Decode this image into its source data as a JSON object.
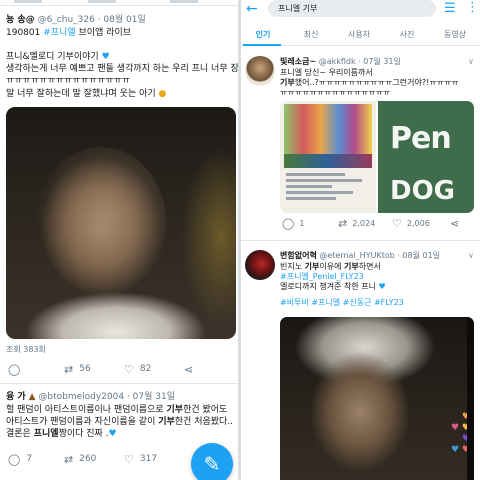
{
  "left_pane": {
    "top_tweet": {
      "user_name": "뇽 송@",
      "handle_date": "@6_chu_326 · 08월 01일",
      "line1_date": "190801",
      "line1_tag": "#프니엘",
      "line1_rest": "브이앱 라이브",
      "line2": "프니&멜로디 기부이야기",
      "line3": "생각하는게 너무 예쁘고 팬들 생각까지 하는 우리 프니 너무 장해",
      "line4": "ㅠㅠㅠㅠㅠㅠㅠㅠㅠㅠㅠㅠㅠㅠㅠ",
      "line5": "말 너무 잘하는데 말 잘했냐며 웃는 아기",
      "views": "조회 383회",
      "retweet_count": "56",
      "like_count": "82"
    },
    "second_tweet": {
      "user_name": "융 가",
      "handle_date": "@btobmelody2004 · 07월 31일",
      "line1_pre": "헐 팬덤이 아티스트이름이나 팬덤이름으로",
      "line1_bold": "기부",
      "line1_post": "한건 봤어도",
      "line2_pre": "아티스트가 팬덤이름과 자신이름을 같이",
      "line2_bold": "기부",
      "line2_post": "한건 처음봤다..",
      "line3_pre": "결론은",
      "line3_bold": "프니엘",
      "line3_post": "짱이다 진짜 .",
      "reply_count": "7",
      "retweet_count": "260",
      "like_count": "317"
    },
    "fab_icon": "compose-tweet-icon"
  },
  "right_pane": {
    "search_query": "프니엘 기부",
    "tabs": [
      "인기",
      "최신",
      "사용자",
      "사진",
      "동영상"
    ],
    "active_tab": "인기",
    "tweet1": {
      "user_name": "빛레소금~",
      "handle_date": "@akkfldk · 07월 31일",
      "line1": "프니엘 당신~ 우리이름까서",
      "line2_bold": "기부",
      "line2_rest": "했어..?ㅠㅠㅠㅠㅠㅠㅠㅠㅠㅠ그런거야?!ㅠㅠㅠㅠ",
      "line3": "ㅠㅠㅠㅠㅠㅠㅠㅠㅠㅠㅠㅠㅠㅠㅠ",
      "image_b_line1": "Pen",
      "image_b_line2": "DOG",
      "reply_count": "1",
      "retweet_count": "2,024",
      "like_count": "2,006"
    },
    "tweet2": {
      "user_name": "변함없어혁",
      "handle_date": "@eternal_HYUKtob · 08월 01일",
      "line1_pre": "빈지노",
      "line1_bold": "기부",
      "line1_mid": "이유에",
      "line1_bold2": "기부",
      "line1_post": "하면서",
      "line2_tag": "#프니엘_Peniel_FLY23",
      "line3": "멜로디까지 챙겨준 착한 프니",
      "tags": "#비투비 #프니엘 #신동근 #FLY23"
    }
  },
  "colors": {
    "accent_blue": "#1da1f2",
    "text_primary": "#14171a",
    "text_secondary": "#657786",
    "divider": "#e1e8ed"
  }
}
